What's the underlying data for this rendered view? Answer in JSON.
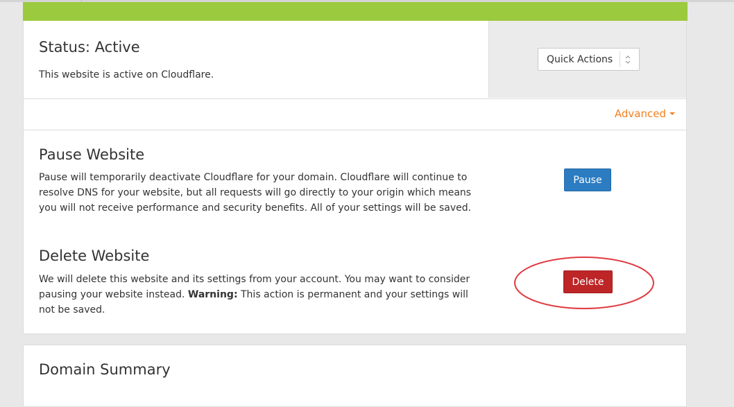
{
  "status": {
    "title": "Status: Active",
    "description": "This website is active on Cloudflare."
  },
  "quick_actions": {
    "label": "Quick Actions",
    "icon": "updown-arrows-icon"
  },
  "advanced": {
    "label": "Advanced",
    "icon": "caret-down-icon"
  },
  "pause_section": {
    "title": "Pause Website",
    "description": "Pause will temporarily deactivate Cloudflare for your domain. Cloudflare will continue to resolve DNS for your website, but all requests will go directly to your origin which means you will not receive performance and security benefits. All of your settings will be saved.",
    "button_label": "Pause"
  },
  "delete_section": {
    "title": "Delete Website",
    "description_part1": "We will delete this website and its settings from your account. You may want to consider pausing your website instead.",
    "warning_label": "Warning:",
    "description_part2": "This action is permanent and your settings will not be saved.",
    "button_label": "Delete"
  },
  "domain_summary": {
    "title": "Domain Summary"
  },
  "colors": {
    "accent_green": "#9bca3e",
    "link_orange": "#f38020",
    "pause_blue": "#2c7cc1",
    "delete_red": "#bd2527",
    "annotation_red": "#e0393e"
  }
}
